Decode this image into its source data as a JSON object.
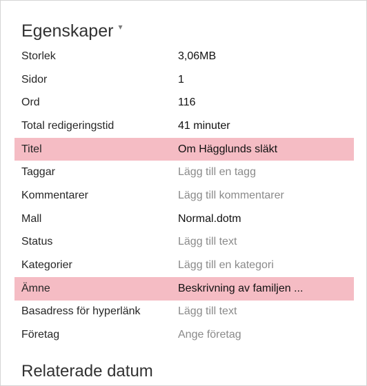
{
  "properties_section": {
    "title": "Egenskaper",
    "caret": "▾",
    "rows": [
      {
        "label": "Storlek",
        "value": "3,06MB"
      },
      {
        "label": "Sidor",
        "value": "1"
      },
      {
        "label": "Ord",
        "value": "116"
      },
      {
        "label": "Total redigeringstid",
        "value": "41 minuter"
      },
      {
        "label": "Titel",
        "value": "Om Hägglunds släkt"
      },
      {
        "label": "Taggar",
        "value": "Lägg till en tagg"
      },
      {
        "label": "Kommentarer",
        "value": "Lägg till kommentarer"
      },
      {
        "label": "Mall",
        "value": "Normal.dotm"
      },
      {
        "label": "Status",
        "value": "Lägg till text"
      },
      {
        "label": "Kategorier",
        "value": "Lägg till en kategori"
      },
      {
        "label": "Ämne",
        "value": "Beskrivning av familjen ..."
      },
      {
        "label": "Basadress för hyperlänk",
        "value": "Lägg till text"
      },
      {
        "label": "Företag",
        "value": "Ange företag"
      }
    ]
  },
  "related_dates_section": {
    "title": "Relaterade datum"
  },
  "colors": {
    "highlight_row": "#f5bcc4",
    "placeholder_text": "#8a8a8a",
    "value_text": "#111111"
  }
}
